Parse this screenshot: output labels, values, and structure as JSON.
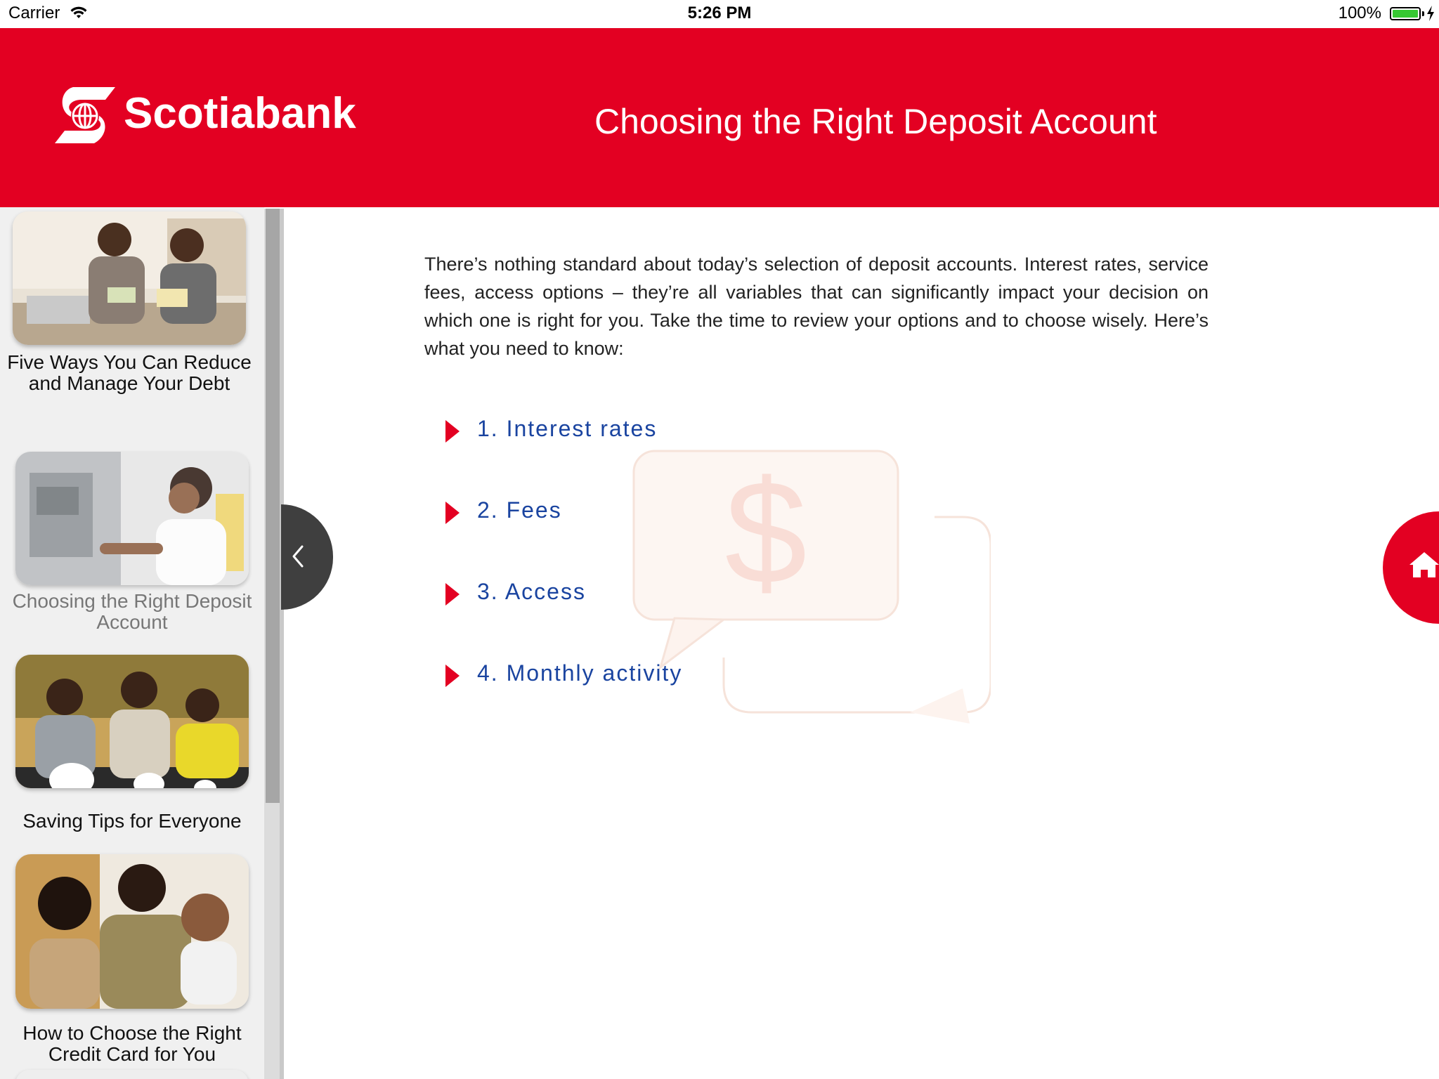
{
  "status_bar": {
    "carrier": "Carrier",
    "time": "5:26 PM",
    "battery": "100%"
  },
  "header": {
    "brand": "Scotiabank",
    "title": "Choosing the Right Deposit Account",
    "color": "#e30022"
  },
  "sidebar": {
    "items": [
      {
        "label": "Five Ways You Can Reduce and Manage Your Debt",
        "active": false
      },
      {
        "label": "Choosing the Right Deposit Account",
        "active": true
      },
      {
        "label": "Saving Tips for Everyone",
        "active": false
      },
      {
        "label": "How to Choose the Right Credit Card for You",
        "active": false
      }
    ]
  },
  "main": {
    "intro": "There’s nothing standard about today’s selection of deposit accounts. Interest rates, service fees, access options – they’re all variables that can significantly impact your decision on which one is right for you. Take the time to review your options and to choose wisely. Here’s what you need to know:",
    "topics": [
      {
        "label": "1. Interest rates"
      },
      {
        "label": "2. Fees"
      },
      {
        "label": "3. Access"
      },
      {
        "label": "4. Monthly activity"
      }
    ],
    "link_color": "#1a44a0"
  },
  "icons": {
    "collapse": "chevron-left-icon",
    "home": "home-icon",
    "topic_bullet": "play-triangle-icon"
  }
}
